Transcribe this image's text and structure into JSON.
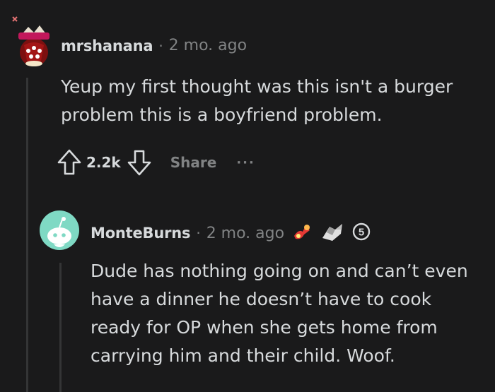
{
  "comments": [
    {
      "username": "mrshanana",
      "separator": "·",
      "time": "2 mo. ago",
      "body": "Yeup my first thought was this isn't a burger problem this is a boyfriend problem.",
      "score": "2.2k",
      "share_label": "Share",
      "more_label": "···"
    },
    {
      "username": "MonteBurns",
      "separator": "·",
      "time": "2 mo. ago",
      "body": "Dude has nothing going on and can’t even have a dinner he doesn’t have to cook ready for OP when she gets home from carrying him and their child. Woof.",
      "awards": [
        "award-icon-1",
        "award-icon-2",
        "award-icon-3"
      ],
      "award_count_label": "5"
    }
  ]
}
